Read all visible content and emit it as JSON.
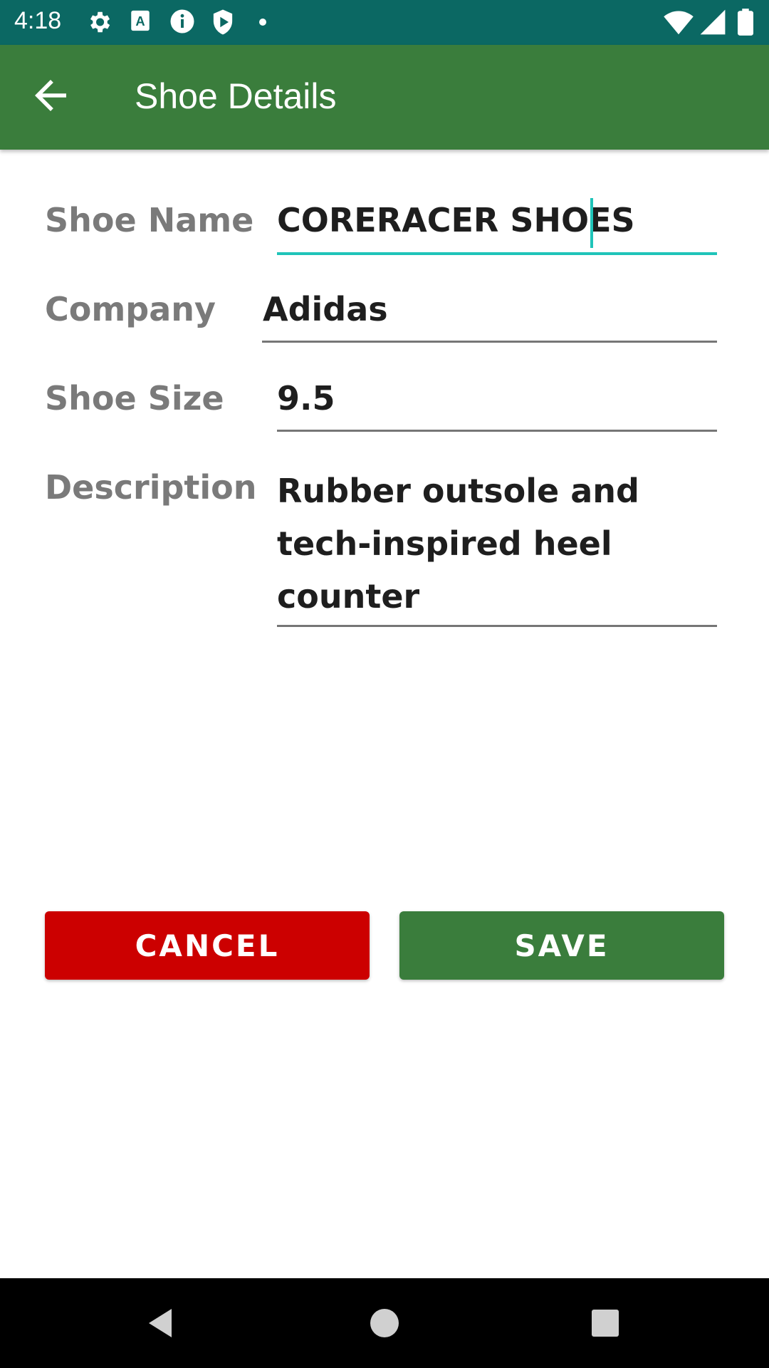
{
  "status_bar": {
    "time": "4:18",
    "icons_left": [
      "settings-icon",
      "text-a-icon",
      "info-icon",
      "shield-play-icon",
      "dot-icon"
    ],
    "icons_right": [
      "wifi-icon",
      "signal-icon",
      "battery-icon"
    ]
  },
  "app_bar": {
    "back_icon": "arrow-back-icon",
    "title": "Shoe Details"
  },
  "form": {
    "shoe_name": {
      "label": "Shoe Name",
      "value": "CORERACER SHOES"
    },
    "company": {
      "label": "Company",
      "value": "Adidas"
    },
    "shoe_size": {
      "label": "Shoe Size",
      "value": "9.5"
    },
    "description": {
      "label": "Description",
      "value": "Rubber outsole and\ntech-inspired heel\ncounter"
    }
  },
  "buttons": {
    "cancel": "CANCEL",
    "save": "SAVE"
  },
  "colors": {
    "status_bar": "#0b6863",
    "app_bar": "#3a7d3c",
    "accent": "#1fc4b9",
    "cancel": "#cc0000",
    "save": "#3a7d3c"
  },
  "nav_bar": {
    "icons": [
      "back-triangle-icon",
      "home-circle-icon",
      "recents-square-icon"
    ]
  }
}
